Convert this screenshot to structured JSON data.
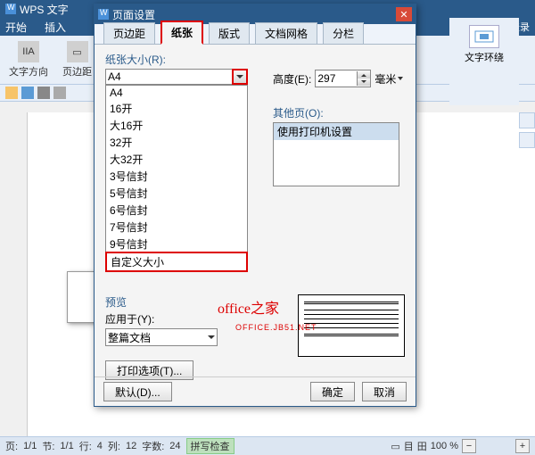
{
  "app": {
    "title": "WPS 文字"
  },
  "ribbon": {
    "start": "开始",
    "insert": "插入",
    "page_margin": "页边距",
    "login": "登录",
    "text_direction": "文字方向",
    "text_wrap": "文字环绕"
  },
  "dialog": {
    "title": "页面设置",
    "tabs": {
      "margin": "页边距",
      "paper": "纸张",
      "layout": "版式",
      "grid": "文档网格",
      "columns": "分栏"
    },
    "paper_size_label": "纸张大小(R):",
    "paper_size_value": "A4",
    "paper_options": [
      "A4",
      "16开",
      "大16开",
      "32开",
      "大32开",
      "3号信封",
      "5号信封",
      "6号信封",
      "7号信封",
      "9号信封",
      "自定义大小"
    ],
    "height_label": "高度(E):",
    "height_value": "297",
    "unit": "毫米",
    "other_pages_label": "其他页(O):",
    "other_pages_value": "使用打印机设置",
    "preview_label": "预览",
    "apply_to_label": "应用于(Y):",
    "apply_to_value": "整篇文档",
    "print_options": "打印选项(T)...",
    "default": "默认(D)...",
    "ok": "确定",
    "cancel": "取消"
  },
  "watermark": {
    "main": "office之家",
    "sub": "OFFICE.JB51.NET"
  },
  "status": {
    "page": "页:",
    "page_val": "1/1",
    "section": "节:",
    "section_val": "1/1",
    "row": "行:",
    "row_val": "4",
    "col": "列:",
    "col_val": "12",
    "chars": "字数:",
    "chars_val": "24",
    "spellcheck": "拼写检查",
    "zoom": "100 %"
  },
  "chart_data": null
}
